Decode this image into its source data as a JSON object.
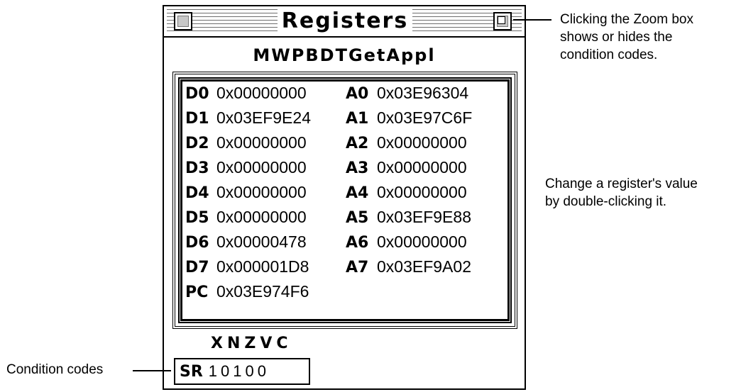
{
  "window": {
    "title": "Registers",
    "app_name": "MWPBDTGetAppl"
  },
  "registers": {
    "data": [
      {
        "name": "D0",
        "value": "0x00000000"
      },
      {
        "name": "D1",
        "value": "0x03EF9E24"
      },
      {
        "name": "D2",
        "value": "0x00000000"
      },
      {
        "name": "D3",
        "value": "0x00000000"
      },
      {
        "name": "D4",
        "value": "0x00000000"
      },
      {
        "name": "D5",
        "value": "0x00000000"
      },
      {
        "name": "D6",
        "value": "0x00000478"
      },
      {
        "name": "D7",
        "value": "0x000001D8"
      }
    ],
    "address": [
      {
        "name": "A0",
        "value": "0x03E96304"
      },
      {
        "name": "A1",
        "value": "0x03E97C6F"
      },
      {
        "name": "A2",
        "value": "0x00000000"
      },
      {
        "name": "A3",
        "value": "0x00000000"
      },
      {
        "name": "A4",
        "value": "0x00000000"
      },
      {
        "name": "A5",
        "value": "0x03EF9E88"
      },
      {
        "name": "A6",
        "value": "0x00000000"
      },
      {
        "name": "A7",
        "value": "0x03EF9A02"
      }
    ],
    "pc": {
      "name": "PC",
      "value": "0x03E974F6"
    }
  },
  "condition_codes": {
    "labels": "XNZVC",
    "sr_name": "SR",
    "sr_value": "10100"
  },
  "annotations": {
    "zoom_line1": "Clicking the Zoom box",
    "zoom_line2": "shows or hides the",
    "zoom_line3": "condition codes.",
    "change_line1": "Change a register's value",
    "change_line2": "by double-clicking it.",
    "condition_codes": "Condition codes"
  },
  "icons": {
    "close": "close-box-icon",
    "zoom": "zoom-box-icon"
  }
}
